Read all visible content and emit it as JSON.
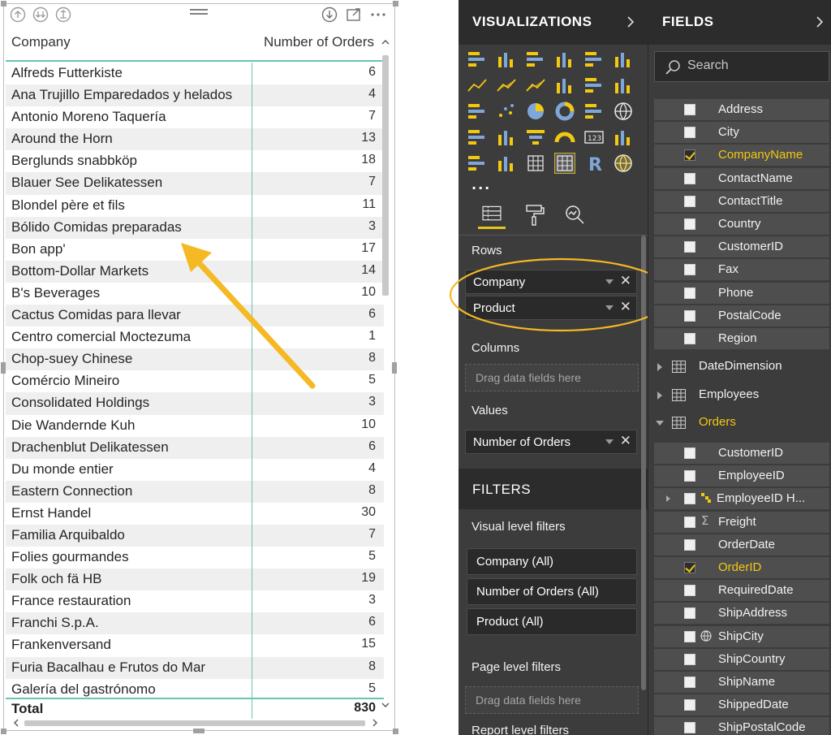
{
  "table": {
    "header": {
      "company": "Company",
      "orders": "Number of Orders"
    },
    "rows": [
      {
        "company": "Alfreds Futterkiste",
        "orders": "6"
      },
      {
        "company": "Ana Trujillo Emparedados y helados",
        "orders": "4"
      },
      {
        "company": "Antonio Moreno Taquería",
        "orders": "7"
      },
      {
        "company": "Around the Horn",
        "orders": "13"
      },
      {
        "company": "Berglunds snabbköp",
        "orders": "18"
      },
      {
        "company": "Blauer See Delikatessen",
        "orders": "7"
      },
      {
        "company": "Blondel père et fils",
        "orders": "11"
      },
      {
        "company": "Bólido Comidas preparadas",
        "orders": "3"
      },
      {
        "company": "Bon app'",
        "orders": "17"
      },
      {
        "company": "Bottom-Dollar Markets",
        "orders": "14"
      },
      {
        "company": "B's Beverages",
        "orders": "10"
      },
      {
        "company": "Cactus Comidas para llevar",
        "orders": "6"
      },
      {
        "company": "Centro comercial Moctezuma",
        "orders": "1"
      },
      {
        "company": "Chop-suey Chinese",
        "orders": "8"
      },
      {
        "company": "Comércio Mineiro",
        "orders": "5"
      },
      {
        "company": "Consolidated Holdings",
        "orders": "3"
      },
      {
        "company": "Die Wandernde Kuh",
        "orders": "10"
      },
      {
        "company": "Drachenblut Delikatessen",
        "orders": "6"
      },
      {
        "company": "Du monde entier",
        "orders": "4"
      },
      {
        "company": "Eastern Connection",
        "orders": "8"
      },
      {
        "company": "Ernst Handel",
        "orders": "30"
      },
      {
        "company": "Familia Arquibaldo",
        "orders": "7"
      },
      {
        "company": "Folies gourmandes",
        "orders": "5"
      },
      {
        "company": "Folk och fä HB",
        "orders": "19"
      },
      {
        "company": "France restauration",
        "orders": "3"
      },
      {
        "company": "Franchi S.p.A.",
        "orders": "6"
      },
      {
        "company": "Frankenversand",
        "orders": "15"
      },
      {
        "company": "Furia Bacalhau e Frutos do Mar",
        "orders": "8"
      },
      {
        "company": "Galería del gastrónomo",
        "orders": "5"
      }
    ],
    "total": {
      "label": "Total",
      "value": "830"
    }
  },
  "visualizations": {
    "title": "VISUALIZATIONS",
    "more": "...",
    "rows_label": "Rows",
    "rows_fields": [
      "Company",
      "Product"
    ],
    "columns_label": "Columns",
    "columns_placeholder": "Drag data fields here",
    "values_label": "Values",
    "values_fields": [
      "Number of Orders"
    ],
    "filters_title": "FILTERS",
    "visual_filters_label": "Visual level filters",
    "visual_filters": [
      "Company  (All)",
      "Number of Orders  (All)",
      "Product  (All)"
    ],
    "page_filters_label": "Page level filters",
    "page_filters_placeholder": "Drag data fields here",
    "report_filters_label": "Report level filters"
  },
  "fields": {
    "title": "FIELDS",
    "search_placeholder": "Search",
    "customer_fields": [
      {
        "name": "Address",
        "checked": false
      },
      {
        "name": "City",
        "checked": false
      },
      {
        "name": "CompanyName",
        "checked": true
      },
      {
        "name": "ContactName",
        "checked": false
      },
      {
        "name": "ContactTitle",
        "checked": false
      },
      {
        "name": "Country",
        "checked": false
      },
      {
        "name": "CustomerID",
        "checked": false
      },
      {
        "name": "Fax",
        "checked": false
      },
      {
        "name": "Phone",
        "checked": false
      },
      {
        "name": "PostalCode",
        "checked": false
      },
      {
        "name": "Region",
        "checked": false
      }
    ],
    "tables": [
      "DateDimension",
      "Employees",
      "Orders"
    ],
    "order_fields": [
      {
        "name": "CustomerID",
        "checked": false,
        "icon": ""
      },
      {
        "name": "EmployeeID",
        "checked": false,
        "icon": ""
      },
      {
        "name": "EmployeeID H...",
        "checked": false,
        "icon": "hierarchy-icon"
      },
      {
        "name": "Freight",
        "checked": false,
        "icon": "sigma-icon"
      },
      {
        "name": "OrderDate",
        "checked": false,
        "icon": ""
      },
      {
        "name": "OrderID",
        "checked": true,
        "icon": ""
      },
      {
        "name": "RequiredDate",
        "checked": false,
        "icon": ""
      },
      {
        "name": "ShipAddress",
        "checked": false,
        "icon": ""
      },
      {
        "name": "ShipCity",
        "checked": false,
        "icon": "globe-icon"
      },
      {
        "name": "ShipCountry",
        "checked": false,
        "icon": ""
      },
      {
        "name": "ShipName",
        "checked": false,
        "icon": ""
      },
      {
        "name": "ShippedDate",
        "checked": false,
        "icon": ""
      },
      {
        "name": "ShipPostalCode",
        "checked": false,
        "icon": ""
      }
    ]
  },
  "colors": {
    "accent": "#f2c811",
    "annotation": "#f4b923",
    "table_rule": "#67c5b4",
    "pane_bg": "#3c3c3c",
    "pane_header_bg": "#2c2c2c"
  }
}
